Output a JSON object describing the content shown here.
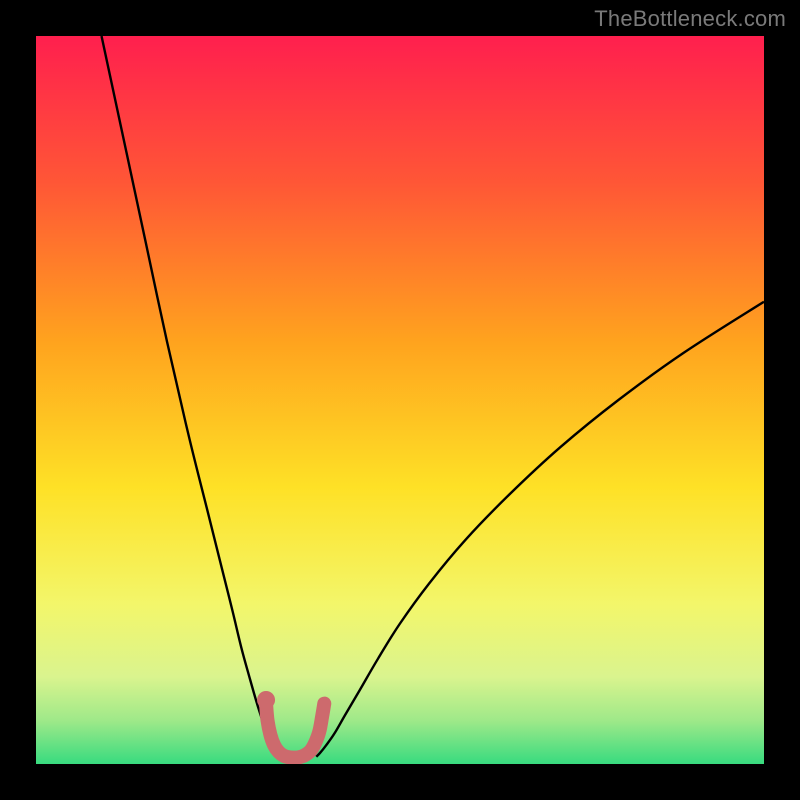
{
  "watermark": {
    "text": "TheBottleneck.com"
  },
  "chart_data": {
    "type": "line",
    "title": "",
    "xlabel": "",
    "ylabel": "",
    "xlim": [
      0,
      100
    ],
    "ylim": [
      0,
      100
    ],
    "grid": false,
    "legend": false,
    "background_gradient_stops": [
      {
        "pos": 0.0,
        "color": "#ff1f4e"
      },
      {
        "pos": 0.2,
        "color": "#ff5636"
      },
      {
        "pos": 0.42,
        "color": "#ffa31e"
      },
      {
        "pos": 0.62,
        "color": "#fee126"
      },
      {
        "pos": 0.78,
        "color": "#f3f66a"
      },
      {
        "pos": 0.88,
        "color": "#daf48e"
      },
      {
        "pos": 0.94,
        "color": "#9fe989"
      },
      {
        "pos": 1.0,
        "color": "#38db7f"
      }
    ],
    "series": [
      {
        "name": "left-curve",
        "x": [
          9.0,
          12.0,
          15.0,
          18.0,
          21.0,
          23.5,
          25.5,
          27.0,
          28.2,
          29.3,
          30.3,
          31.1,
          31.8,
          32.2,
          32.5,
          32.7,
          32.9,
          33.0
        ],
        "values": [
          100.0,
          86.0,
          72.0,
          58.0,
          45.0,
          35.0,
          27.0,
          21.0,
          16.0,
          12.0,
          8.5,
          6.0,
          4.2,
          3.0,
          2.2,
          1.6,
          1.2,
          1.0
        ]
      },
      {
        "name": "right-curve",
        "x": [
          38.5,
          39.0,
          39.8,
          41.0,
          42.5,
          44.5,
          47.0,
          50.0,
          54.0,
          59.0,
          65.0,
          72.0,
          80.0,
          89.0,
          100.0
        ],
        "values": [
          1.0,
          1.5,
          2.5,
          4.2,
          6.8,
          10.2,
          14.5,
          19.3,
          24.8,
          30.8,
          37.0,
          43.5,
          50.0,
          56.5,
          63.5
        ]
      }
    ],
    "highlight_segment": {
      "name": "minimum-band",
      "color": "#cd6a6d",
      "points_xy": [
        [
          31.6,
          8.3
        ],
        [
          31.8,
          6.0
        ],
        [
          32.2,
          4.0
        ],
        [
          32.7,
          2.6
        ],
        [
          33.3,
          1.7
        ],
        [
          34.1,
          1.1
        ],
        [
          35.0,
          0.9
        ],
        [
          36.0,
          0.9
        ],
        [
          36.9,
          1.2
        ],
        [
          37.7,
          1.8
        ],
        [
          38.3,
          2.8
        ],
        [
          38.9,
          4.4
        ],
        [
          39.3,
          6.5
        ],
        [
          39.6,
          8.3
        ]
      ],
      "dot_xy": [
        31.6,
        8.8
      ]
    },
    "annotations": []
  }
}
